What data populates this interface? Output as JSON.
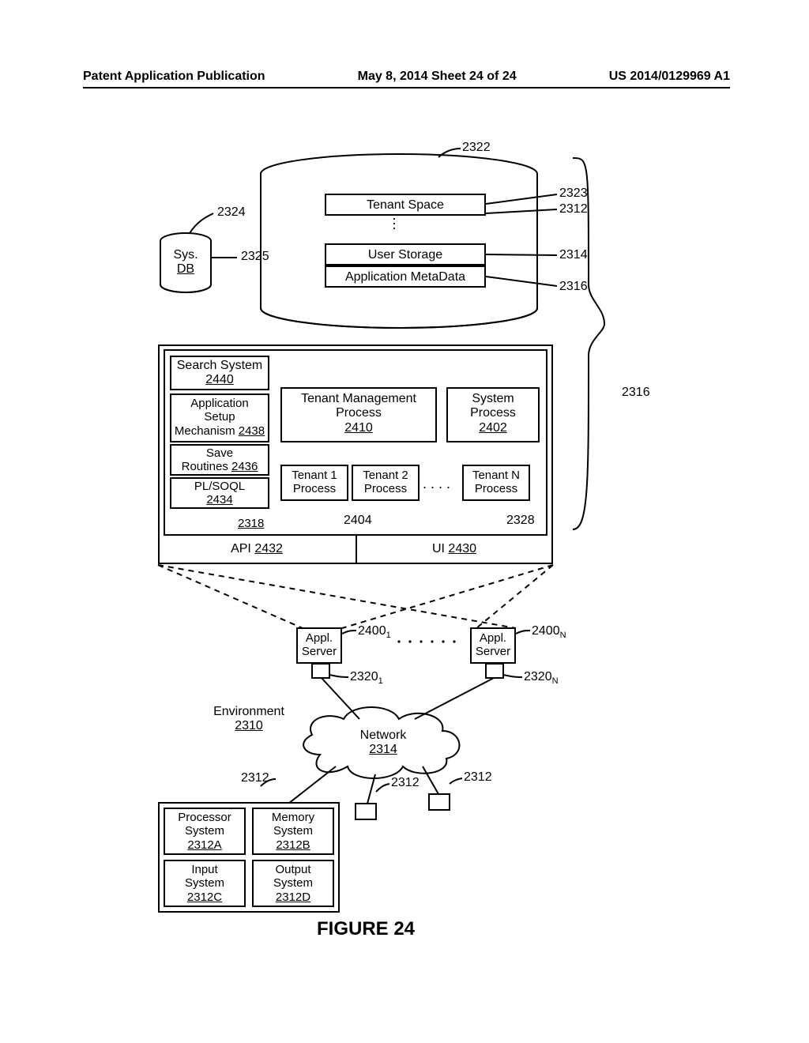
{
  "header": {
    "left": "Patent Application Publication",
    "center": "May 8, 2014  Sheet 24 of 24",
    "right": "US 2014/0129969 A1"
  },
  "figure_title": "FIGURE 24",
  "db": {
    "tenant_space": "Tenant Space",
    "user_storage": "User Storage",
    "app_metadata": "Application MetaData",
    "sys": "Sys.",
    "sysdb": "DB"
  },
  "proc": {
    "search_system": "Search System",
    "search_system_ref": "2440",
    "app_setup1": "Application",
    "app_setup2": "Setup",
    "app_setup3": "Mechanism",
    "app_setup_ref": "2438",
    "save": "Save",
    "routines": "Routines",
    "routines_ref": "2436",
    "plsoql": "PL/SOQL",
    "plsoql_ref": "2434",
    "apis_ref": "2318",
    "tenant_mgmt1": "Tenant Management",
    "tenant_mgmt2": "Process",
    "tenant_mgmt_ref": "2410",
    "sys_proc1": "System",
    "sys_proc2": "Process",
    "sys_proc_ref": "2402",
    "t1a": "Tenant 1",
    "t1b": "Process",
    "t2a": "Tenant 2",
    "t2b": "Process",
    "tna": "Tenant N",
    "tnb": "Process",
    "api": "API",
    "api_ref": "2432",
    "ui": "UI",
    "ui_ref": "2430"
  },
  "servers": {
    "appl": "Appl.",
    "server": "Server"
  },
  "env": {
    "environment": "Environment",
    "environment_ref": "2310",
    "network": "Network",
    "network_ref": "2314"
  },
  "client": {
    "proc1": "Processor",
    "proc2": "System",
    "proc_ref": "2312A",
    "mem1": "Memory",
    "mem2": "System",
    "mem_ref": "2312B",
    "in1": "Input",
    "in2": "System",
    "in_ref": "2312C",
    "out1": "Output",
    "out2": "System",
    "out_ref": "2312D"
  },
  "refs": {
    "r2322": "2322",
    "r2323": "2323",
    "r2312a": "2312",
    "r2314a": "2314",
    "r2316a": "2316",
    "r2324": "2324",
    "r2325": "2325",
    "r2316b": "2316",
    "r2404": "2404",
    "r2328": "2328",
    "r2400_1": "2400",
    "r2400_n": "2400",
    "r2320_1": "2320",
    "r2320_n": "2320",
    "r2312b": "2312",
    "r2312c": "2312",
    "r2312d": "2312"
  }
}
